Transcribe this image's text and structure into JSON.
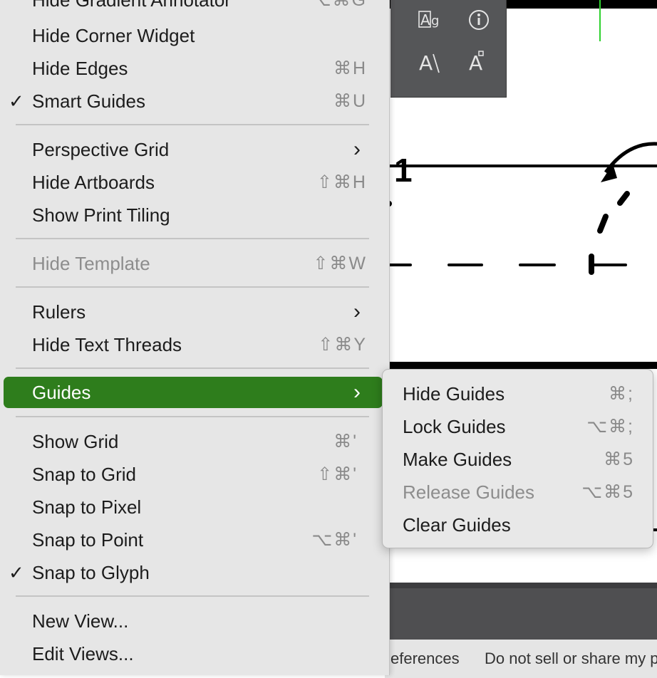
{
  "menu": {
    "items": [
      {
        "label": "Hide Gradient Annotator",
        "shortcut": "⌥⌘G"
      },
      {
        "label": "Hide Corner Widget",
        "shortcut": ""
      },
      {
        "label": "Hide Edges",
        "shortcut": "⌘H"
      },
      {
        "label": "Smart Guides",
        "shortcut": "⌘U",
        "checked": true
      },
      {
        "label": "Perspective Grid",
        "submenu": true
      },
      {
        "label": "Hide Artboards",
        "shortcut": "⇧⌘H"
      },
      {
        "label": "Show Print Tiling",
        "shortcut": ""
      },
      {
        "label": "Hide Template",
        "shortcut": "⇧⌘W",
        "disabled": true
      },
      {
        "label": "Rulers",
        "submenu": true
      },
      {
        "label": "Hide Text Threads",
        "shortcut": "⇧⌘Y"
      },
      {
        "label": "Guides",
        "submenu": true,
        "highlighted": true
      },
      {
        "label": "Show Grid",
        "shortcut": "⌘'"
      },
      {
        "label": "Snap to Grid",
        "shortcut": "⇧⌘'"
      },
      {
        "label": "Snap to Pixel",
        "shortcut": ""
      },
      {
        "label": "Snap to Point",
        "shortcut": "⌥⌘'"
      },
      {
        "label": "Snap to Glyph",
        "shortcut": "",
        "checked": true
      },
      {
        "label": "New View...",
        "shortcut": ""
      },
      {
        "label": "Edit Views...",
        "shortcut": ""
      }
    ],
    "checkmark": "✓",
    "submenu_arrow": "›",
    "highlight_color": "#2e7d1c"
  },
  "guides_submenu": {
    "items": [
      {
        "label": "Hide Guides",
        "shortcut": "⌘;"
      },
      {
        "label": "Lock Guides",
        "shortcut": "⌥⌘;"
      },
      {
        "label": "Make Guides",
        "shortcut": "⌘5"
      },
      {
        "label": "Release Guides",
        "shortcut": "⌥⌘5",
        "disabled": true
      },
      {
        "label": "Clear Guides",
        "shortcut": ""
      }
    ]
  },
  "canvas": {
    "artboard_number": "1"
  },
  "tool_panel": {
    "icons": [
      "glyph-icon",
      "info-icon",
      "text-warp-icon",
      "text-touch-icon"
    ]
  },
  "footer": {
    "left_text": "eferences",
    "right_text": "Do not sell or share my p"
  }
}
